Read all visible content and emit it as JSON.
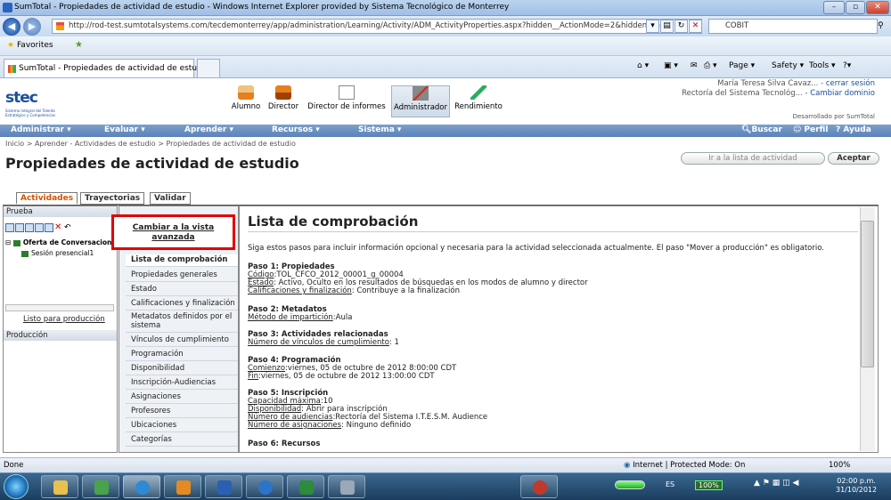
{
  "window": {
    "title": "SumTotal - Propiedades de actividad de estudio - Windows Internet Explorer provided by Sistema Tecnológico de Monterrey"
  },
  "address_bar": {
    "url": "http://rod-test.sumtotalsystems.com/tecdemonterrey/app/administration/Learning/Activity/ADM_ActivityProperties.aspx?hidden__ActionMode=2&hidden__Activ",
    "search_value": "COBIT"
  },
  "favorites_bar": {
    "favorites_label": "Favorites"
  },
  "browser_tab": {
    "label": "SumTotal - Propiedades de actividad de estudio"
  },
  "command_bar": {
    "page": "Page ▾",
    "safety": "Safety ▾",
    "tools": "Tools ▾",
    "help": "?▾"
  },
  "header": {
    "logo_text": "stec",
    "logo_subtext": "Sistema Integral del Talento Estratégico y Competencias",
    "roles": [
      "Alumno",
      "Director",
      "Director de informes",
      "Administrador",
      "Rendimiento"
    ],
    "user_name": "María Teresa Silva Cavaz...",
    "logout_link": "cerrar sesión",
    "domain_name": "Rectoría del Sistema Tecnológ...",
    "change_domain_link": "Cambiar dominio",
    "developed_by": "Desarrollado por SumTotal"
  },
  "menu": {
    "items": [
      "Administrar ▾",
      "Evaluar ▾",
      "Aprender ▾",
      "Recursos ▾",
      "Sistema ▾"
    ],
    "search": "Buscar",
    "profile": "Perfil",
    "help": "Ayuda"
  },
  "breadcrumb": "Inicio > Aprender - Actividades de estudio > Propiedades de actividad de estudio",
  "page_title": "Propiedades de actividad de estudio",
  "buttons": {
    "go_to_list": "Ir a la lista de actividad",
    "accept": "Aceptar"
  },
  "page_tabs": [
    "Actividades",
    "Trayectorias",
    "Validar"
  ],
  "left_panel": {
    "test_header": "Prueba",
    "tree_root": "Oferta de Conversacione",
    "tree_child": "Sesión presencial1",
    "ready_link": "Listo para producción",
    "production_header": "Producción"
  },
  "nav": {
    "advanced_view": "Cambiar a la vista avanzada",
    "items": [
      "Lista de comprobación",
      "Propiedades generales",
      "Estado",
      "Calificaciones y finalización",
      "Metadatos definidos por el sistema",
      "Vínculos de cumplimiento",
      "Programación",
      "Disponibilidad",
      "Inscripción-Audiencias",
      "Asignaciones",
      "Profesores",
      "Ubicaciones",
      "Categorías"
    ]
  },
  "content": {
    "title": "Lista de comprobación",
    "intro": "Siga estos pasos para incluir información opcional y necesaria para la actividad seleccionada actualmente. El paso \"Mover a producción\" es obligatorio.",
    "steps": [
      {
        "title": "Paso 1: Propiedades",
        "lines": [
          [
            "Código",
            ":TOL_CFCO_2012_00001_g_00004"
          ],
          [
            "Estado",
            ": Activo, Oculto en los resultados de búsquedas en los modos de alumno y director"
          ],
          [
            "Calificaciones y finalización",
            ": Contribuye a la finalización"
          ]
        ]
      },
      {
        "title": "Paso 2: Metadatos",
        "lines": [
          [
            "Método de impartición",
            ":Aula"
          ]
        ]
      },
      {
        "title": "Paso 3: Actividades relacionadas",
        "lines": [
          [
            "Número de vínculos de cumplimiento",
            ": 1"
          ]
        ]
      },
      {
        "title": "Paso 4: Programación",
        "lines": [
          [
            "Comienzo",
            ":viernes, 05 de octubre de 2012 8:00:00 CDT"
          ],
          [
            "Fin",
            ":viernes, 05 de octubre de 2012 13:00:00 CDT"
          ]
        ]
      },
      {
        "title": "Paso 5: Inscripción",
        "lines": [
          [
            "Capacidad máxima",
            ":10"
          ],
          [
            "Disponibilidad",
            ": Abrir para inscripción"
          ],
          [
            "Número de audiencias",
            ":Rectoría del Sistema I.T.E.S.M. Audience"
          ],
          [
            "Número de asignaciones",
            ": Ninguno definido"
          ]
        ]
      },
      {
        "title": "Paso 6: Recursos",
        "lines": []
      }
    ]
  },
  "status_bar": {
    "left": "Done",
    "zone": "Internet | Protected Mode: On",
    "zoom": "100%"
  },
  "taskbar": {
    "lang": "ES",
    "zoom_badge": "100%",
    "time": "02:00 p.m.",
    "date": "31/10/2012"
  }
}
